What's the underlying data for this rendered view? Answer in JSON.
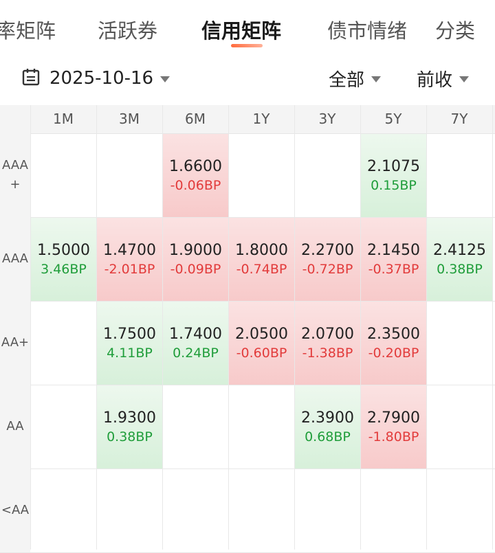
{
  "tabs": [
    "率矩阵",
    "活跃券",
    "信用矩阵",
    "债市情绪",
    "分类"
  ],
  "active_tab": 2,
  "filter": {
    "date": "2025-10-16",
    "scope": "全部",
    "compare": "前收"
  },
  "matrix": {
    "columns": [
      "1M",
      "3M",
      "6M",
      "1Y",
      "3Y",
      "5Y",
      "7Y"
    ],
    "rows": [
      {
        "label": "AAA\n+",
        "cells": [
          null,
          null,
          {
            "value": "1.6600",
            "change": "-0.06BP",
            "dir": "up"
          },
          null,
          null,
          {
            "value": "2.1075",
            "change": "0.15BP",
            "dir": "down"
          },
          null
        ]
      },
      {
        "label": "AAA",
        "cells": [
          {
            "value": "1.5000",
            "change": "3.46BP",
            "dir": "down"
          },
          {
            "value": "1.4700",
            "change": "-2.01BP",
            "dir": "up"
          },
          {
            "value": "1.9000",
            "change": "-0.09BP",
            "dir": "up"
          },
          {
            "value": "1.8000",
            "change": "-0.74BP",
            "dir": "up"
          },
          {
            "value": "2.2700",
            "change": "-0.72BP",
            "dir": "up"
          },
          {
            "value": "2.1450",
            "change": "-0.37BP",
            "dir": "up"
          },
          {
            "value": "2.4125",
            "change": "0.38BP",
            "dir": "down"
          }
        ]
      },
      {
        "label": "AA+",
        "cells": [
          null,
          {
            "value": "1.7500",
            "change": "4.11BP",
            "dir": "down"
          },
          {
            "value": "1.7400",
            "change": "0.24BP",
            "dir": "down"
          },
          {
            "value": "2.0500",
            "change": "-0.60BP",
            "dir": "up"
          },
          {
            "value": "2.0700",
            "change": "-1.38BP",
            "dir": "up"
          },
          {
            "value": "2.3500",
            "change": "-0.20BP",
            "dir": "up"
          },
          null
        ]
      },
      {
        "label": "AA",
        "cells": [
          null,
          {
            "value": "1.9300",
            "change": "0.38BP",
            "dir": "down"
          },
          null,
          null,
          {
            "value": "2.3900",
            "change": "0.68BP",
            "dir": "down"
          },
          {
            "value": "2.7900",
            "change": "-1.80BP",
            "dir": "up"
          },
          null
        ]
      },
      {
        "label": "<AA",
        "cells": [
          null,
          null,
          null,
          null,
          null,
          null,
          null
        ]
      }
    ]
  }
}
